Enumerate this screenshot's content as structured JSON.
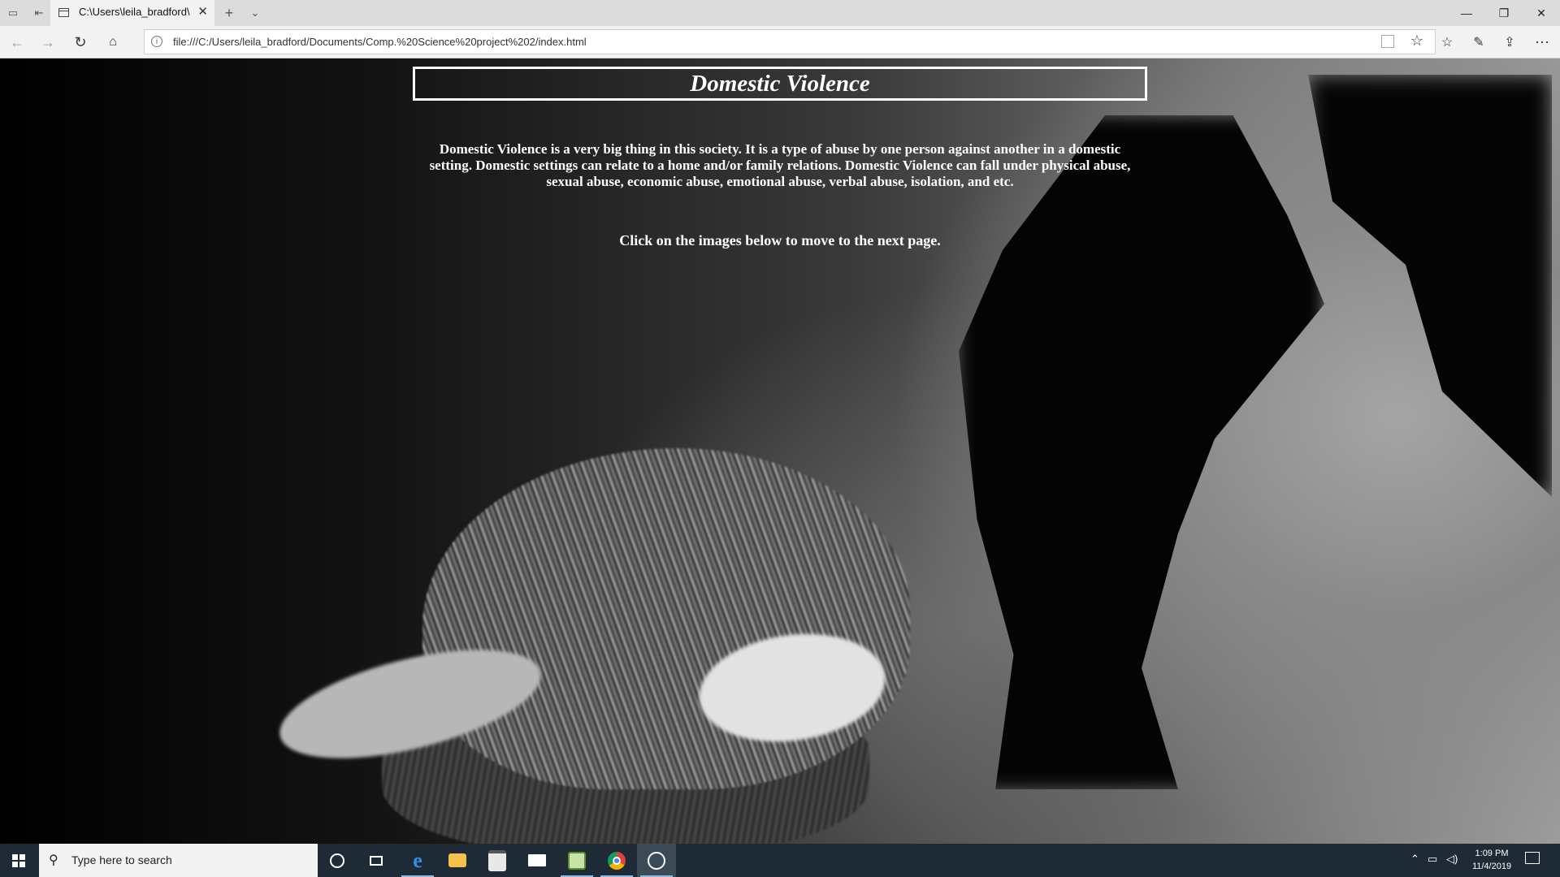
{
  "browser": {
    "tab_title": "C:\\Users\\leila_bradford\\",
    "url": "file:///C:/Users/leila_bradford/Documents/Comp.%20Science%20project%202/index.html"
  },
  "page": {
    "title": "Domestic Violence",
    "intro": "Domestic Violence is a very big thing in this society. It is a type of abuse by one person against another in a domestic setting. Domestic settings can relate to a home and/or family relations. Domestic Violence can fall under physical abuse, sexual abuse, economic abuse, emotional abuse, verbal abuse, isolation, and etc.",
    "instruction": "Click on the images below to move to the next page."
  },
  "taskbar": {
    "search_placeholder": "Type here to search",
    "time": "1:09 PM",
    "date": "11/4/2019",
    "apps": [
      "cortana-icon",
      "task-view-icon",
      "edge-icon",
      "file-explorer-icon",
      "store-icon",
      "mail-icon",
      "notepad-icon",
      "chrome-icon",
      "xbox-icon"
    ]
  }
}
